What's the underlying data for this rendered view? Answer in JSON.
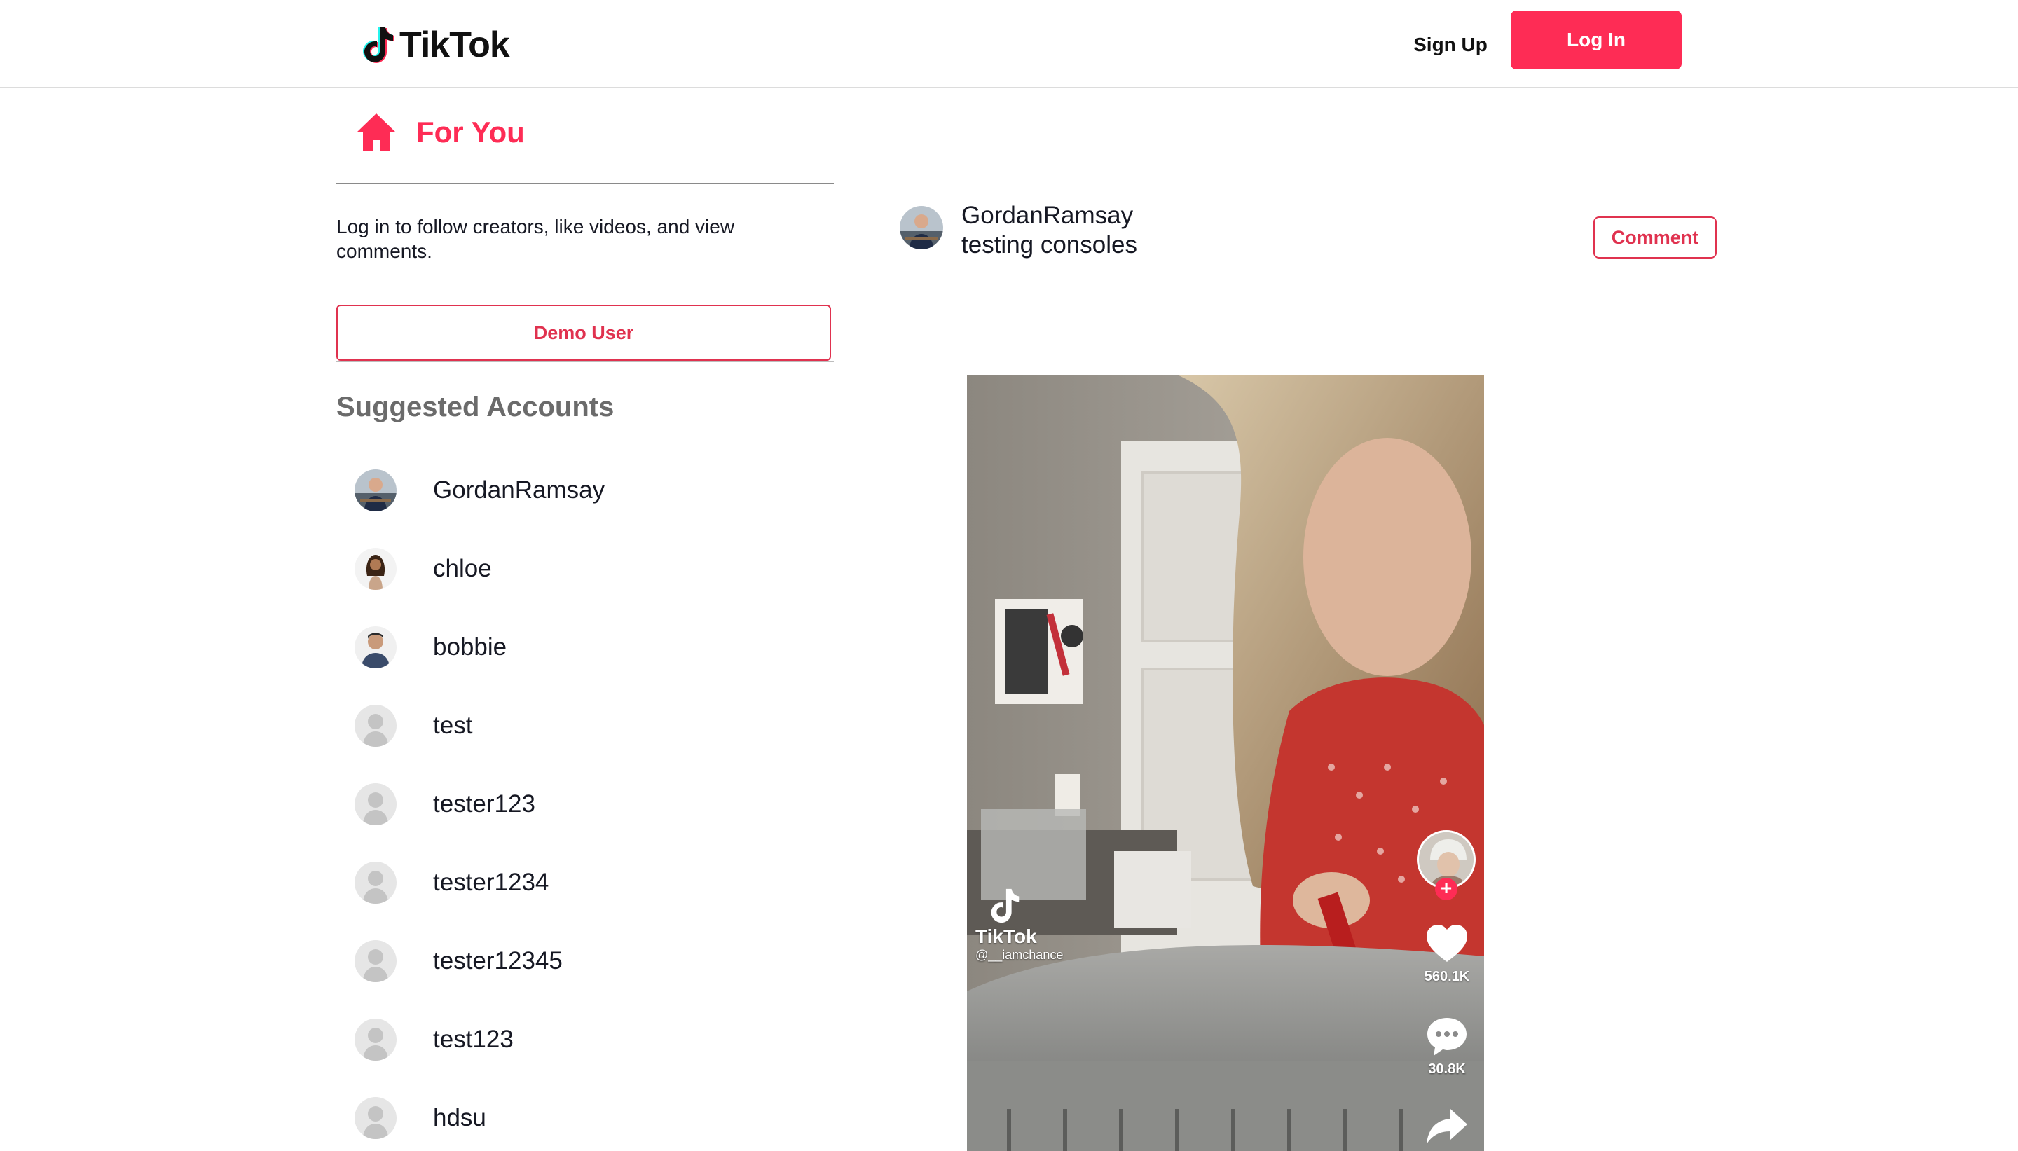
{
  "header": {
    "logo_text": "TikTok",
    "signup_label": "Sign Up",
    "login_label": "Log In"
  },
  "sidebar": {
    "nav_label": "For You",
    "login_prompt": "Log in to follow creators, like videos, and view comments.",
    "demo_user_label": "Demo User",
    "suggested_title": "Suggested Accounts",
    "accounts": [
      {
        "name": "GordanRamsay",
        "avatar": "photo-chef"
      },
      {
        "name": "chloe",
        "avatar": "photo-woman"
      },
      {
        "name": "bobbie",
        "avatar": "photo-man"
      },
      {
        "name": "test",
        "avatar": "default-avatar"
      },
      {
        "name": "tester123",
        "avatar": "default-avatar"
      },
      {
        "name": "tester1234",
        "avatar": "default-avatar"
      },
      {
        "name": "tester12345",
        "avatar": "default-avatar"
      },
      {
        "name": "test123",
        "avatar": "default-avatar"
      },
      {
        "name": "hdsu",
        "avatar": "default-avatar"
      }
    ]
  },
  "post": {
    "username": "GordanRamsay",
    "caption": "testing consoles",
    "comment_label": "Comment",
    "video": {
      "watermark_text": "TikTok",
      "watermark_handle": "@__iamchance",
      "likes": "560.1K",
      "comments": "30.8K"
    }
  },
  "colors": {
    "brand": "#fe2c55",
    "outline_red": "#e0324f"
  }
}
